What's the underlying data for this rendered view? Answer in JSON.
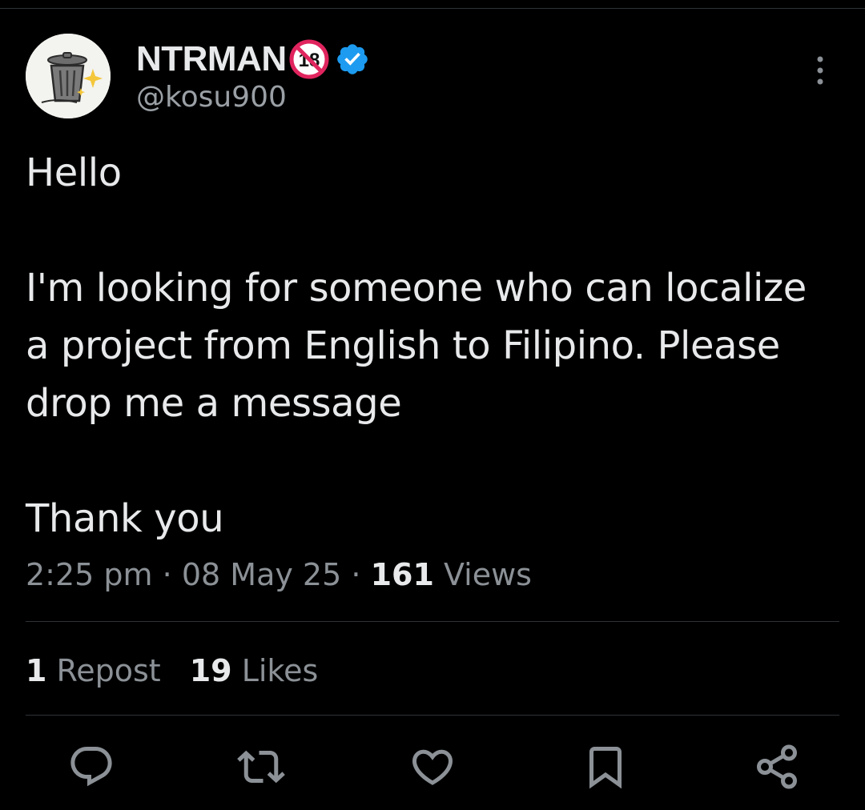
{
  "author": {
    "display_name": "NTRMAN",
    "handle": "@kosu900",
    "badges": [
      "no-18-icon",
      "verified-badge-icon"
    ],
    "verified_color": "#1d9bf0"
  },
  "tweet": {
    "text": "Hello\n\nI'm looking for someone who can localize a project from English to Filipino. Please drop me a message\n\nThank you",
    "time": "2:25 pm",
    "date": "08 May 25",
    "views_count": "161",
    "views_label": "Views",
    "separator": "·"
  },
  "engagement": {
    "reposts_count": "1",
    "reposts_label": "Repost",
    "likes_count": "19",
    "likes_label": "Likes"
  },
  "actions": [
    "reply-icon",
    "repost-icon",
    "like-icon",
    "bookmark-icon",
    "share-icon"
  ],
  "colors": {
    "background": "#000000",
    "text": "#e7e9ea",
    "secondary_text": "#8b9196",
    "divider": "#2f3336",
    "icon": "#8b9196"
  }
}
